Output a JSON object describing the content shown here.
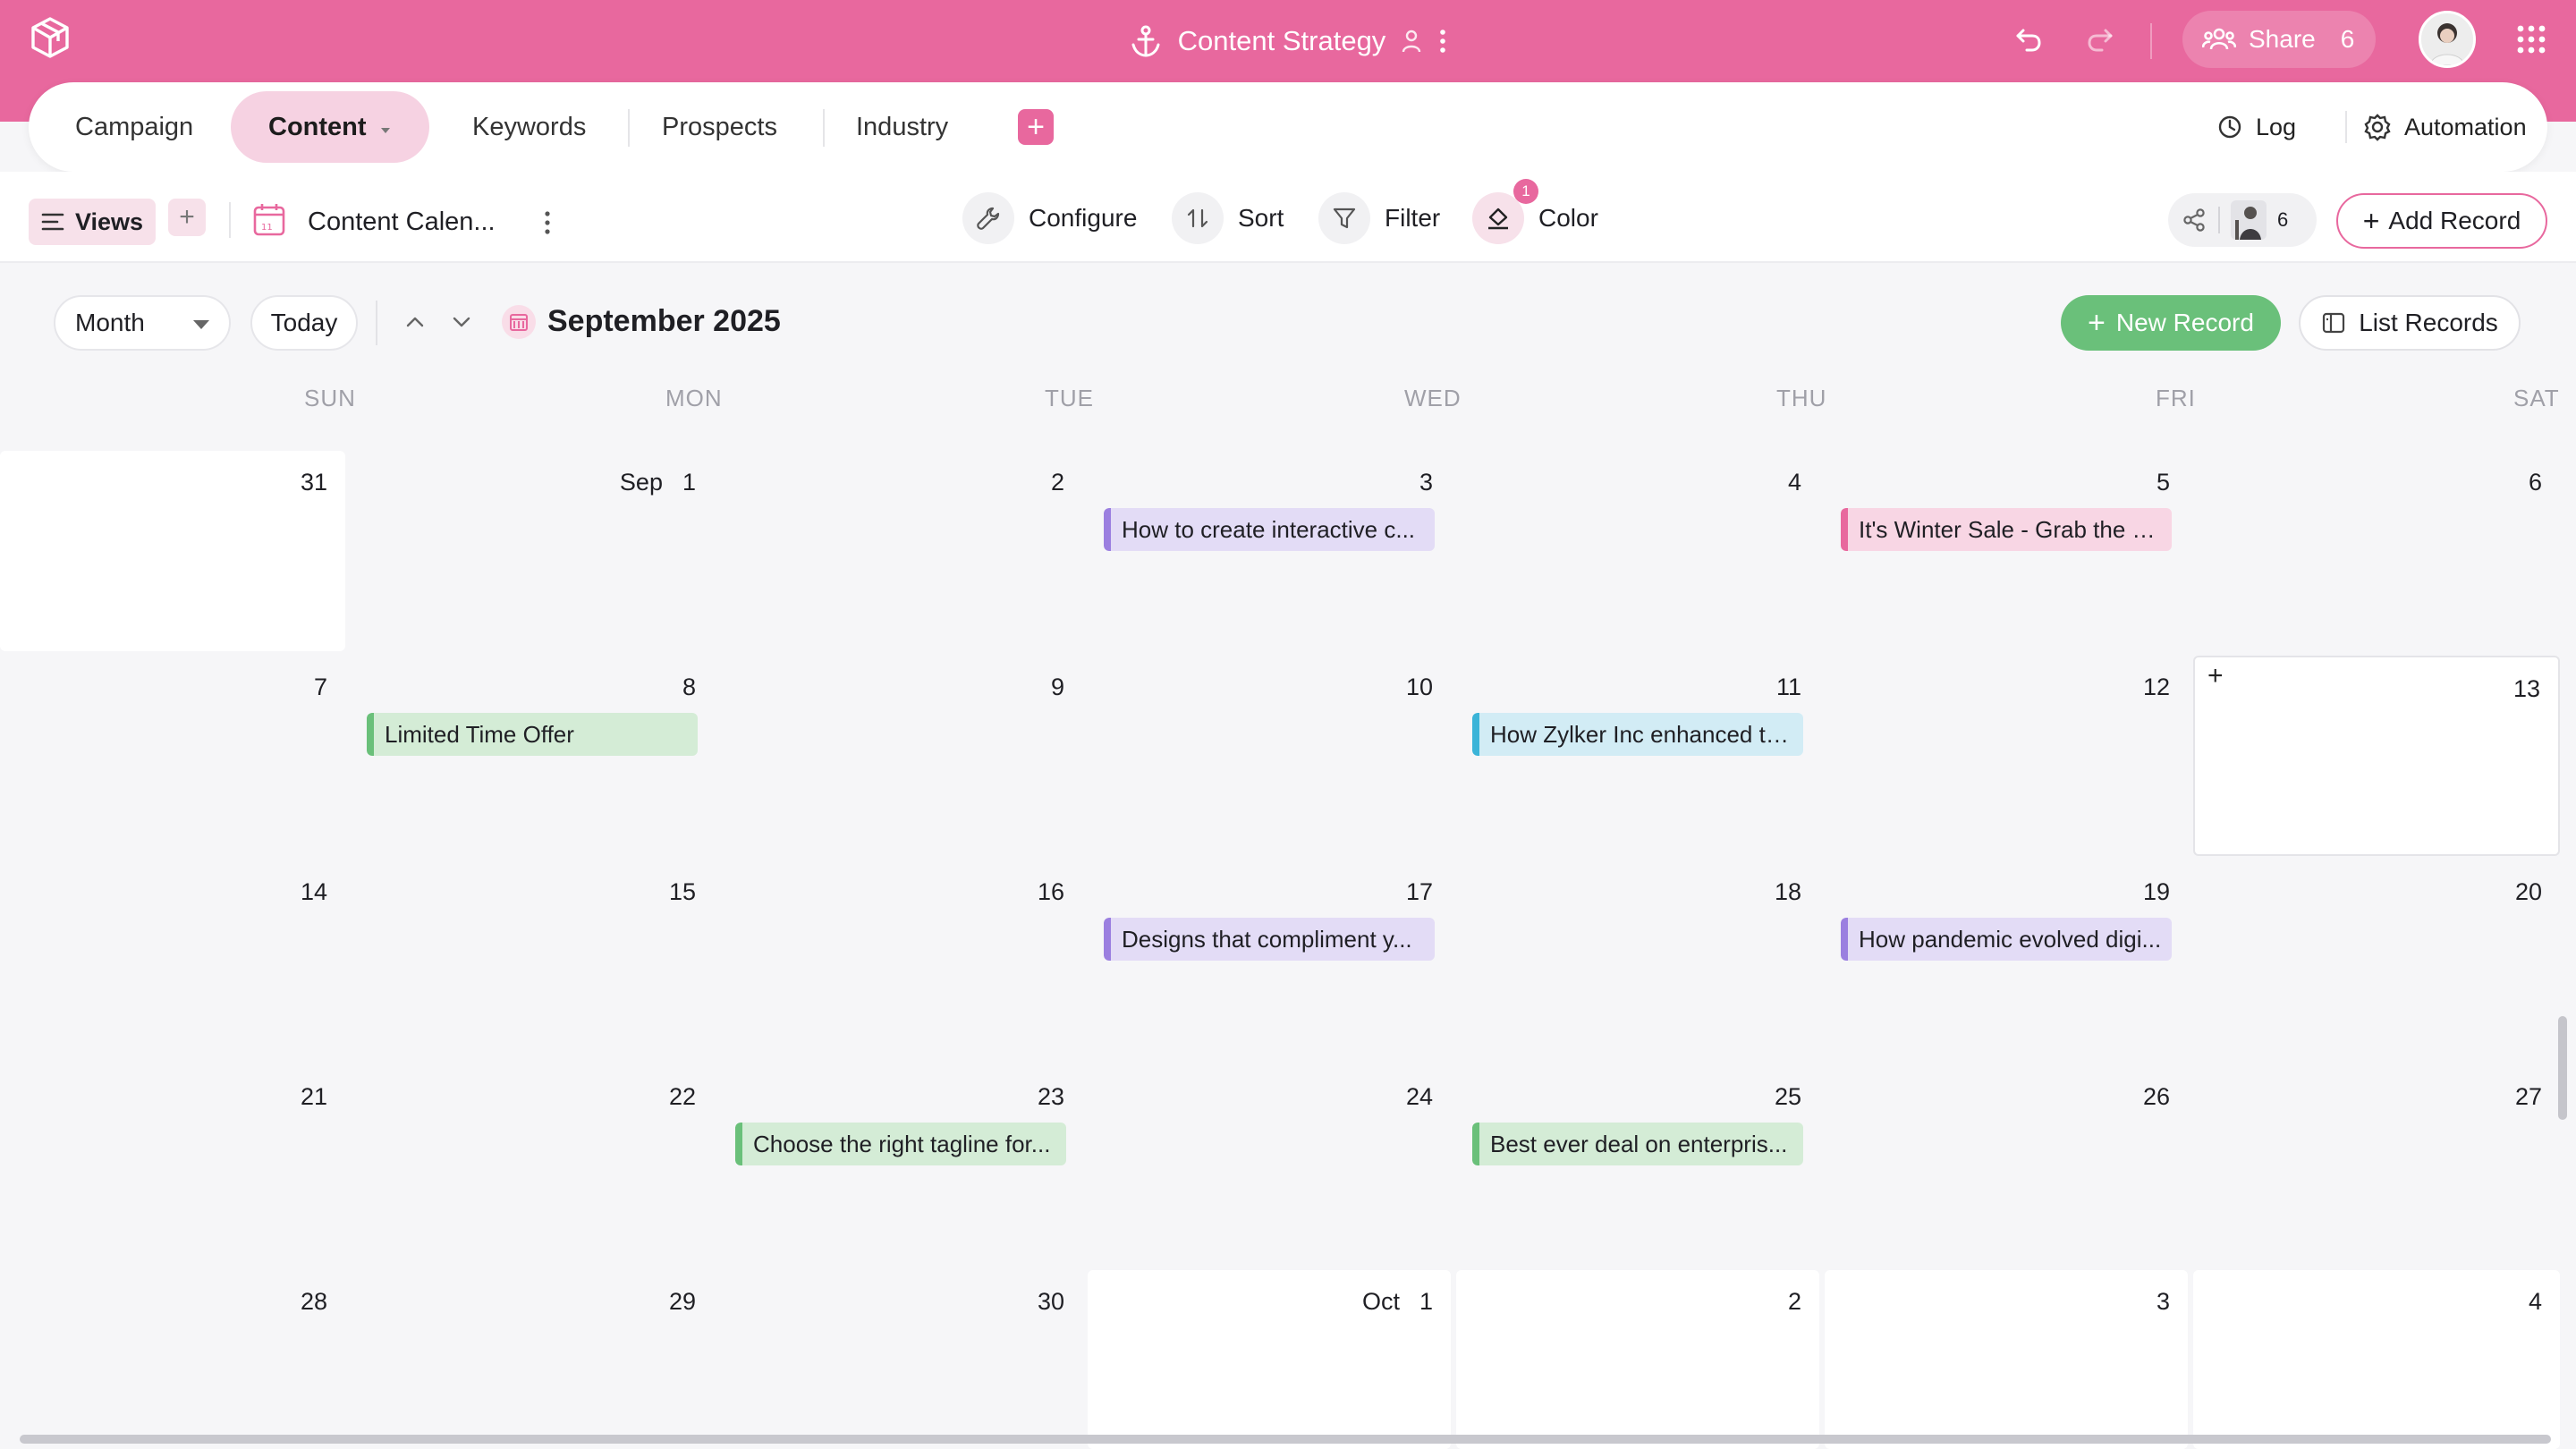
{
  "app": {
    "title": "Content Strategy",
    "share_label": "Share",
    "share_count": "6",
    "accent_color": "#e8689e"
  },
  "tabs": [
    {
      "label": "Campaign"
    },
    {
      "label": "Content",
      "active": true
    },
    {
      "label": "Keywords"
    },
    {
      "label": "Prospects"
    },
    {
      "label": "Industry"
    }
  ],
  "tab_actions": {
    "log": "Log",
    "automation": "Automation"
  },
  "toolbar": {
    "views_label": "Views",
    "view_name": "Content Calen...",
    "configure": "Configure",
    "sort": "Sort",
    "filter": "Filter",
    "color": "Color",
    "color_badge": "1",
    "collaborators_count": "6",
    "add_record": "Add Record"
  },
  "calendar": {
    "mode": "Month",
    "today_label": "Today",
    "period": "September 2025",
    "new_record": "New Record",
    "list_records": "List Records",
    "weekdays": [
      "SUN",
      "MON",
      "TUE",
      "WED",
      "THU",
      "FRI",
      "SAT"
    ],
    "weeks": [
      [
        {
          "day": "31"
        },
        {
          "day": "1",
          "month_label": "Sep"
        },
        {
          "day": "2"
        },
        {
          "day": "3",
          "event": {
            "title": "How to create interactive c...",
            "color": "#9b7fe0",
            "bg": "#e3dcf6"
          }
        },
        {
          "day": "4"
        },
        {
          "day": "5",
          "event": {
            "title": "It's Winter Sale - Grab the O...",
            "color": "#e8689e",
            "bg": "#f8d6e4"
          }
        },
        {
          "day": "6"
        }
      ],
      [
        {
          "day": "7"
        },
        {
          "day": "8",
          "event": {
            "title": "Limited Time Offer",
            "color": "#6ac07a",
            "bg": "#d4ecd6"
          }
        },
        {
          "day": "9"
        },
        {
          "day": "10"
        },
        {
          "day": "11",
          "event": {
            "title": "How Zylker Inc enhanced th...",
            "color": "#3bb4d8",
            "bg": "#d2ecf5"
          }
        },
        {
          "day": "12"
        },
        {
          "day": "13",
          "hovered": true
        }
      ],
      [
        {
          "day": "14"
        },
        {
          "day": "15"
        },
        {
          "day": "16"
        },
        {
          "day": "17",
          "event": {
            "title": "Designs that compliment y...",
            "color": "#9b7fe0",
            "bg": "#e3dcf6"
          }
        },
        {
          "day": "18"
        },
        {
          "day": "19",
          "event": {
            "title": "How pandemic evolved digi...",
            "color": "#9b7fe0",
            "bg": "#e3dcf6"
          }
        },
        {
          "day": "20"
        }
      ],
      [
        {
          "day": "21"
        },
        {
          "day": "22"
        },
        {
          "day": "23",
          "event": {
            "title": "Choose the right tagline for...",
            "color": "#6ac07a",
            "bg": "#d4ecd6"
          }
        },
        {
          "day": "24"
        },
        {
          "day": "25",
          "event": {
            "title": "Best ever deal on enterpris...",
            "color": "#6ac07a",
            "bg": "#d4ecd6"
          }
        },
        {
          "day": "26"
        },
        {
          "day": "27"
        }
      ],
      [
        {
          "day": "28"
        },
        {
          "day": "29"
        },
        {
          "day": "30"
        },
        {
          "day": "1",
          "month_label": "Oct",
          "current_month": false
        },
        {
          "day": "2",
          "current_month": false
        },
        {
          "day": "3",
          "current_month": false
        },
        {
          "day": "4",
          "current_month": false
        }
      ]
    ]
  }
}
